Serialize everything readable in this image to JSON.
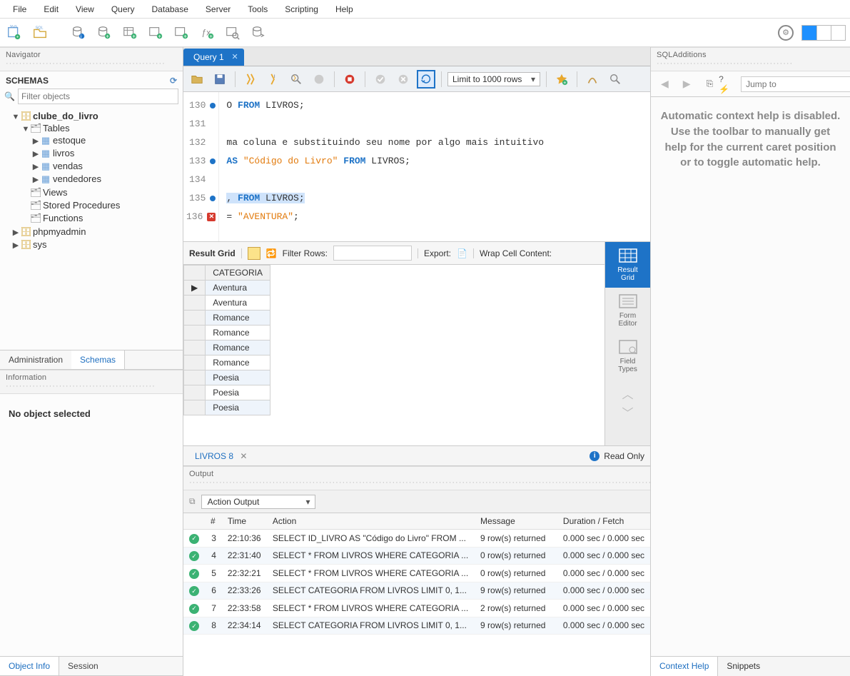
{
  "menubar": [
    "File",
    "Edit",
    "View",
    "Query",
    "Database",
    "Server",
    "Tools",
    "Scripting",
    "Help"
  ],
  "navigator": {
    "title": "Navigator",
    "schemas_label": "SCHEMAS",
    "filter_placeholder": "Filter objects",
    "tree": {
      "db": "clube_do_livro",
      "tables_label": "Tables",
      "tables": [
        "estoque",
        "livros",
        "vendas",
        "vendedores"
      ],
      "views": "Views",
      "stored_procedures": "Stored Procedures",
      "functions": "Functions",
      "other_db1": "phpmyadmin",
      "other_db2": "sys"
    },
    "tabs": {
      "administration": "Administration",
      "schemas": "Schemas"
    },
    "info_title": "Information",
    "info_body": "No object selected",
    "info_tabs": {
      "object_info": "Object Info",
      "session": "Session"
    }
  },
  "query_tab": {
    "label": "Query 1"
  },
  "editor_toolbar": {
    "limit_label": "Limit to 1000 rows"
  },
  "code_lines": [
    {
      "n": 130,
      "mark": "dot",
      "html": "O <span class='kw'>FROM</span> LIVROS;"
    },
    {
      "n": 131,
      "mark": "",
      "html": ""
    },
    {
      "n": 132,
      "mark": "",
      "html": "ma coluna e substituindo seu nome por algo mais intuitivo"
    },
    {
      "n": 133,
      "mark": "dot",
      "html": "<span class='kw'>AS</span> <span class='str'>&quot;Código do Livro&quot;</span> <span class='kw'>FROM</span> LIVROS;"
    },
    {
      "n": 134,
      "mark": "",
      "html": ""
    },
    {
      "n": 135,
      "mark": "dot",
      "html": "<span class='hl'>, <span class='kw'>FROM</span> LIVROS;</span>"
    },
    {
      "n": 136,
      "mark": "err",
      "html": "= <span class='str'>&quot;AVENTURA&quot;</span>;"
    }
  ],
  "results": {
    "label": "Result Grid",
    "filter_label": "Filter Rows:",
    "export_label": "Export:",
    "wrap_label": "Wrap Cell Content:",
    "column": "CATEGORIA",
    "rows": [
      "Aventura",
      "Aventura",
      "Romance",
      "Romance",
      "Romance",
      "Romance",
      "Poesia",
      "Poesia",
      "Poesia"
    ],
    "vtabs": {
      "grid": "Result\nGrid",
      "form": "Form\nEditor",
      "field": "Field\nTypes"
    },
    "tab_label": "LIVROS 8",
    "readonly": "Read Only"
  },
  "additions": {
    "title": "SQLAdditions",
    "jump_placeholder": "Jump to",
    "help_text": "Automatic context help is disabled. Use the toolbar to manually get help for the current caret position or to toggle automatic help.",
    "tabs": {
      "context": "Context Help",
      "snippets": "Snippets"
    }
  },
  "output": {
    "title": "Output",
    "selector": "Action Output",
    "columns": [
      "",
      "#",
      "Time",
      "Action",
      "Message",
      "Duration / Fetch"
    ],
    "rows": [
      {
        "n": 3,
        "time": "22:10:36",
        "action": "SELECT ID_LIVRO AS \"Código do Livro\" FROM ...",
        "msg": "9 row(s) returned",
        "dur": "0.000 sec / 0.000 sec"
      },
      {
        "n": 4,
        "time": "22:31:40",
        "action": "SELECT * FROM LIVROS WHERE CATEGORIA ...",
        "msg": "0 row(s) returned",
        "dur": "0.000 sec / 0.000 sec"
      },
      {
        "n": 5,
        "time": "22:32:21",
        "action": "SELECT * FROM LIVROS WHERE CATEGORIA ...",
        "msg": "0 row(s) returned",
        "dur": "0.000 sec / 0.000 sec"
      },
      {
        "n": 6,
        "time": "22:33:26",
        "action": "SELECT CATEGORIA FROM LIVROS LIMIT 0, 1...",
        "msg": "9 row(s) returned",
        "dur": "0.000 sec / 0.000 sec"
      },
      {
        "n": 7,
        "time": "22:33:58",
        "action": "SELECT * FROM LIVROS WHERE CATEGORIA ...",
        "msg": "2 row(s) returned",
        "dur": "0.000 sec / 0.000 sec"
      },
      {
        "n": 8,
        "time": "22:34:14",
        "action": "SELECT CATEGORIA FROM LIVROS LIMIT 0, 1...",
        "msg": "9 row(s) returned",
        "dur": "0.000 sec / 0.000 sec"
      }
    ]
  }
}
